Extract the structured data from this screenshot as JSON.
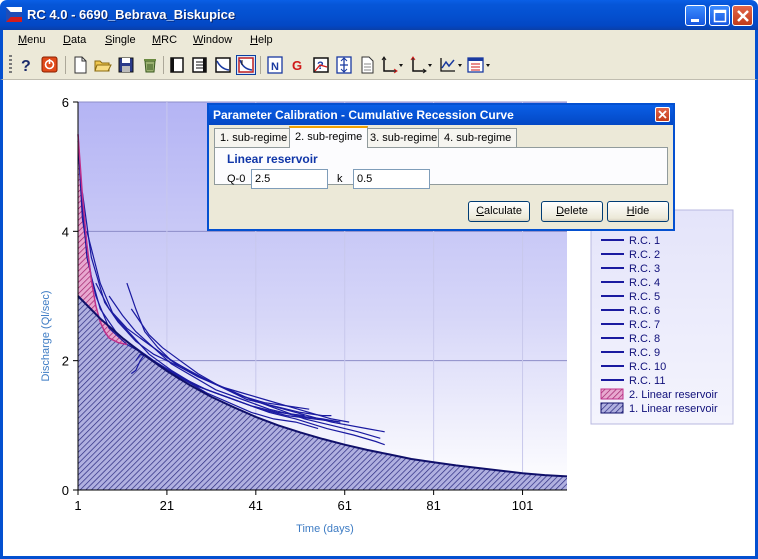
{
  "window": {
    "title": "RC 4.0 - 6690_Bebrava_Biskupice"
  },
  "menu": [
    {
      "pre": "",
      "key": "M",
      "post": "enu"
    },
    {
      "pre": "",
      "key": "D",
      "post": "ata"
    },
    {
      "pre": "",
      "key": "S",
      "post": "ingle"
    },
    {
      "pre": "",
      "key": "M",
      "post": "RC"
    },
    {
      "pre": "",
      "key": "W",
      "post": "indow"
    },
    {
      "pre": "",
      "key": "H",
      "post": "elp"
    }
  ],
  "toolbar": {
    "icons": [
      "help-icon",
      "stop-icon",
      "new-file-icon",
      "open-folder-icon",
      "save-icon",
      "recycle-icon",
      "page-icon",
      "pages-icon",
      "chart-icon",
      "recession-chart-icon",
      "calc-icon",
      "g-icon",
      "question-chart-icon",
      "split-icon",
      "document-icon",
      "axes-dropdown-icon",
      "axes2-dropdown-icon",
      "line-chart-dropdown-icon",
      "list-dropdown-icon"
    ],
    "g_glyph": "G"
  },
  "dialog": {
    "title": "Parameter Calibration - Cumulative Recession Curve",
    "tabs": [
      "1. sub-regime",
      "2. sub-regime",
      "3. sub-regime",
      "4. sub-regime"
    ],
    "active_tab": 1,
    "heading": "Linear reservoir",
    "q0_label": "Q-0",
    "q0_value": "2.5",
    "k_label": "k",
    "k_value": "0.5",
    "buttons": {
      "calculate": {
        "key": "C",
        "rest": "alculate"
      },
      "delete": {
        "key": "D",
        "rest": "elete"
      },
      "hide": {
        "key": "H",
        "rest": "ide"
      }
    }
  },
  "chart_data": {
    "type": "line",
    "xlabel": "Time (days)",
    "ylabel": "Discharge (Ql/sec)",
    "xlim": [
      1,
      111
    ],
    "ylim": [
      0,
      6
    ],
    "xticks": [
      1,
      21,
      41,
      61,
      81,
      101
    ],
    "yticks": [
      0,
      2,
      4,
      6
    ],
    "grid": true,
    "legend_position": "right",
    "colors": {
      "rc": "#1a1aa0",
      "reservoir2": "#c0308a",
      "reservoir1": "#10106a",
      "axis_label": "#3e7cc4"
    },
    "series": [
      {
        "name": "R.C. 1",
        "x": [
          1,
          2,
          3,
          5,
          8,
          12,
          16,
          20,
          25,
          30,
          35,
          40,
          45,
          50,
          55
        ],
        "y": [
          5.5,
          4.4,
          3.6,
          3.0,
          2.5,
          2.25,
          2.1,
          1.9,
          1.7,
          1.5,
          1.35,
          1.2,
          1.1,
          1.05,
          0.95
        ]
      },
      {
        "name": "R.C. 2",
        "x": [
          1,
          2,
          4,
          6,
          10,
          14,
          18,
          24,
          30,
          36,
          42,
          48,
          54,
          60
        ],
        "y": [
          5.4,
          4.2,
          3.3,
          2.8,
          2.4,
          2.2,
          2.0,
          1.75,
          1.55,
          1.4,
          1.25,
          1.15,
          1.1,
          1.05
        ]
      },
      {
        "name": "R.C. 3",
        "x": [
          2,
          4,
          7,
          10,
          14,
          18,
          24,
          30,
          36,
          42,
          50,
          58,
          66,
          70
        ],
        "y": [
          4.6,
          3.6,
          2.9,
          2.6,
          2.3,
          2.1,
          1.9,
          1.7,
          1.5,
          1.35,
          1.2,
          1.05,
          0.95,
          0.9
        ]
      },
      {
        "name": "R.C. 4",
        "x": [
          3,
          6,
          9,
          13,
          17,
          22,
          28,
          34,
          40,
          46,
          52
        ],
        "y": [
          4.0,
          3.2,
          2.7,
          2.4,
          2.1,
          1.85,
          1.6,
          1.45,
          1.3,
          1.2,
          1.15
        ]
      },
      {
        "name": "R.C. 5",
        "x": [
          5,
          8,
          12,
          16,
          21,
          27,
          33,
          39,
          45,
          51,
          56,
          58
        ],
        "y": [
          3.2,
          2.8,
          2.5,
          2.3,
          2.05,
          1.8,
          1.6,
          1.4,
          1.3,
          1.2,
          1.15,
          1.15
        ]
      },
      {
        "name": "R.C. 6",
        "x": [
          8,
          11,
          14,
          18,
          22,
          27,
          32,
          38,
          44,
          50,
          56,
          60
        ],
        "y": [
          3.0,
          2.7,
          2.45,
          2.2,
          1.95,
          1.75,
          1.55,
          1.4,
          1.25,
          1.15,
          1.1,
          1.05
        ]
      },
      {
        "name": "R.C. 7",
        "x": [
          12,
          14,
          16,
          19,
          22,
          26,
          30,
          35,
          40,
          46,
          52,
          58,
          64,
          69
        ],
        "y": [
          3.2,
          2.8,
          2.45,
          2.2,
          2.0,
          1.85,
          1.7,
          1.55,
          1.4,
          1.25,
          1.1,
          1.0,
          0.9,
          0.8
        ]
      },
      {
        "name": "R.C. 8",
        "x": [
          14,
          15,
          17,
          20,
          24,
          28,
          32,
          38,
          44,
          50,
          57,
          63,
          68,
          70
        ],
        "y": [
          2.0,
          2.1,
          2.05,
          1.9,
          1.75,
          1.6,
          1.5,
          1.35,
          1.2,
          1.1,
          0.95,
          0.85,
          0.75,
          0.7
        ]
      },
      {
        "name": "R.C. 9",
        "x": [
          15,
          16,
          18,
          21,
          24,
          28,
          33,
          38,
          43,
          48,
          53,
          58,
          62
        ],
        "y": [
          2.35,
          2.3,
          2.2,
          2.05,
          1.9,
          1.75,
          1.6,
          1.5,
          1.4,
          1.3,
          1.2,
          1.1,
          1.05
        ]
      },
      {
        "name": "R.C. 10",
        "x": [
          13,
          15,
          17,
          20,
          24,
          28,
          33,
          38,
          43,
          48,
          53
        ],
        "y": [
          2.8,
          2.6,
          2.4,
          2.2,
          2.0,
          1.8,
          1.6,
          1.45,
          1.35,
          1.3,
          1.25
        ]
      },
      {
        "name": "R.C. 11",
        "x": [
          13,
          14,
          15,
          16,
          17,
          18,
          19,
          20,
          21,
          22,
          23,
          24
        ],
        "y": [
          1.8,
          1.85,
          2.0,
          2.1,
          2.05,
          2.0,
          1.95,
          1.9,
          1.85,
          1.8,
          1.75,
          1.7
        ]
      }
    ],
    "reservoirs": [
      {
        "name": "2. Linear reservoir",
        "x": [
          1,
          2,
          3,
          4,
          5,
          6,
          7,
          8,
          10,
          12
        ],
        "y": [
          5.5,
          4.55,
          3.8,
          3.25,
          2.85,
          2.6,
          2.45,
          2.35,
          2.28,
          2.25
        ]
      },
      {
        "name": "1. Linear reservoir",
        "x": [
          1,
          6,
          11,
          16,
          21,
          26,
          31,
          36,
          41,
          46,
          51,
          56,
          61,
          66,
          71,
          76,
          81,
          86,
          91,
          96,
          101,
          106,
          111
        ],
        "y": [
          3.0,
          2.65,
          2.35,
          2.08,
          1.84,
          1.63,
          1.44,
          1.28,
          1.13,
          1.0,
          0.89,
          0.79,
          0.7,
          0.62,
          0.55,
          0.48,
          0.43,
          0.38,
          0.34,
          0.3,
          0.26,
          0.23,
          0.21
        ]
      }
    ]
  }
}
